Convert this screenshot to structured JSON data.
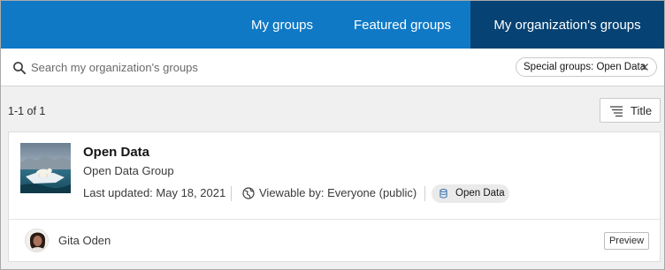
{
  "nav": {
    "tabs": [
      {
        "label": "My groups",
        "active": false
      },
      {
        "label": "Featured groups",
        "active": false
      },
      {
        "label": "My organization's groups",
        "active": true
      }
    ]
  },
  "search": {
    "placeholder": "Search my organization's groups",
    "value": "",
    "filter_chip": "Special groups: Open Data"
  },
  "results": {
    "count": "1-1 of 1",
    "sort_label": "Title"
  },
  "group": {
    "title": "Open Data",
    "subtitle": "Open Data Group",
    "last_updated": "Last updated: May 18, 2021",
    "viewable_by": "Viewable by: Everyone (public)",
    "badge": "Open Data",
    "owner": "Gita Oden",
    "preview_label": "Preview"
  },
  "colors": {
    "nav_bg": "#0f79c6",
    "nav_active_bg": "#064273",
    "page_bg": "#f0f0f0"
  },
  "icons": [
    "search-icon",
    "close-icon",
    "sort-icon",
    "globe-icon",
    "database-icon"
  ]
}
